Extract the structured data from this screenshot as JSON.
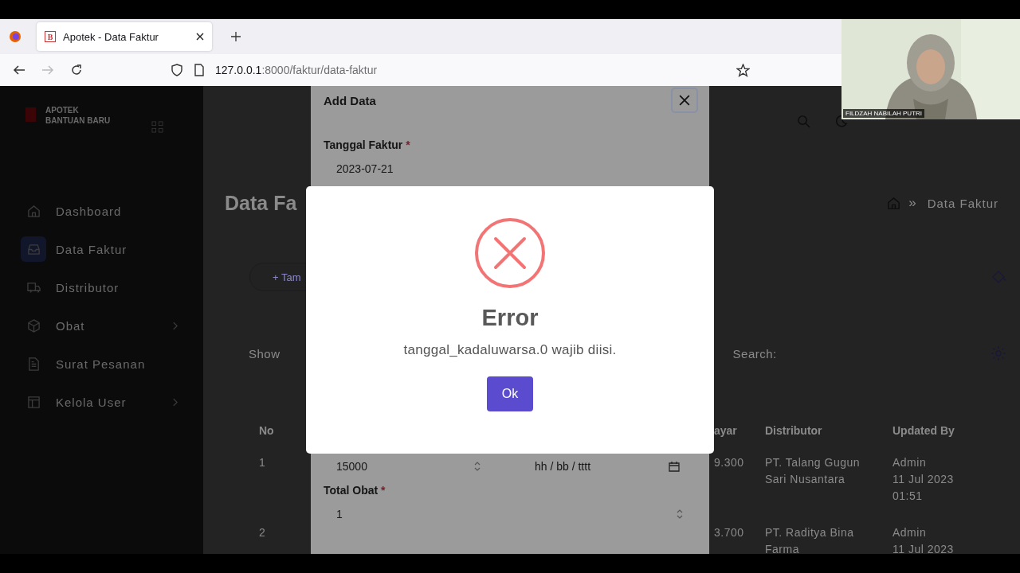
{
  "browser": {
    "tab_title": "Apotek - Data Faktur",
    "tab_favicon": "B",
    "url_host": "127.0.0.1",
    "url_path": ":8000/faktur/data-faktur"
  },
  "sidebar": {
    "brand": [
      "APOTEK",
      "BANTUAN BARU"
    ],
    "items": [
      {
        "label": "Dashboard",
        "kind": "home",
        "selected": false,
        "expandable": false
      },
      {
        "label": "Data Faktur",
        "kind": "inbox",
        "selected": true,
        "expandable": false
      },
      {
        "label": "Distributor",
        "kind": "truck",
        "selected": false,
        "expandable": false
      },
      {
        "label": "Obat",
        "kind": "box",
        "selected": false,
        "expandable": true
      },
      {
        "label": "Surat Pesanan",
        "kind": "file",
        "selected": false,
        "expandable": false
      },
      {
        "label": "Kelola User",
        "kind": "layout",
        "selected": false,
        "expandable": true
      }
    ]
  },
  "main": {
    "title": "Data Fa",
    "add_button": "+ Tam",
    "show_label": "Show",
    "search_label": "Search:",
    "breadcrumb": {
      "separator": "»",
      "current": "Data Faktur"
    },
    "table": {
      "columns": [
        "No",
        "ayar",
        "Distributor",
        "Updated By"
      ],
      "rows": [
        {
          "no": "1",
          "amount": "9.300",
          "distributor": "PT. Talang Gugun Sari Nusantara",
          "updated": [
            "Admin",
            "11 Jul 2023",
            "01:51"
          ]
        },
        {
          "no": "2",
          "amount": "3.700",
          "distributor": "PT. Raditya Bina Farma",
          "updated": [
            "Admin",
            "11 Jul 2023"
          ]
        }
      ]
    }
  },
  "add_modal": {
    "title": "Add Data",
    "date_label": "Tanggal Faktur",
    "date_value": "2023-07-21",
    "number_value": "15000",
    "date_placeholder": "hh / bb / tttt",
    "total_label": "Total Obat",
    "total_value": "1",
    "required_mark": "*"
  },
  "error_dialog": {
    "title": "Error",
    "message": "tanggal_kadaluwarsa.0 wajib diisi.",
    "button": "Ok"
  },
  "webcam": {
    "name": "FILDZAH NABILAH PUTRI"
  }
}
